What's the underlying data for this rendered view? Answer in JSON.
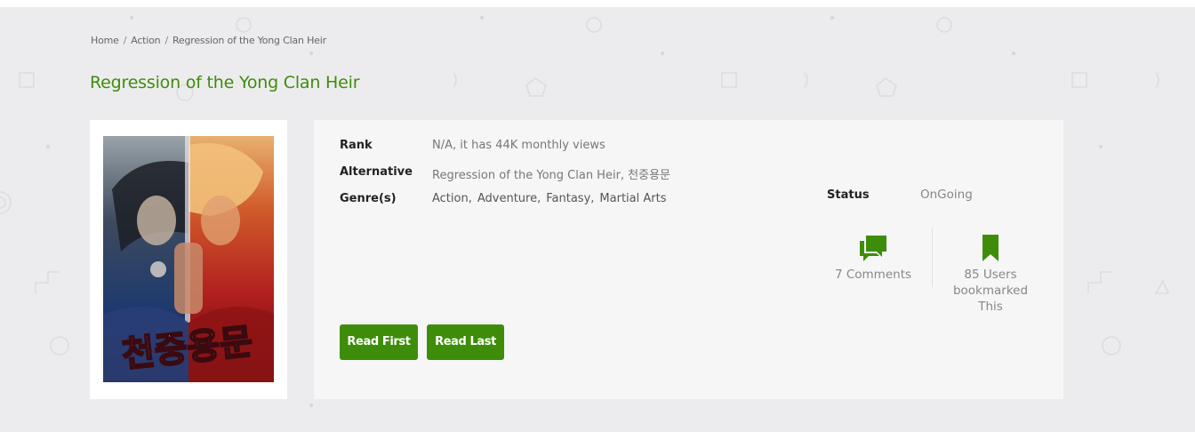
{
  "breadcrumb": {
    "home": "Home",
    "separator": "/",
    "category": "Action",
    "current": "Regression of the Yong Clan Heir"
  },
  "title": "Regression of the Yong Clan Heir",
  "cover": {
    "art_text": "천중용문"
  },
  "info": {
    "rank_label": "Rank",
    "rank_value": "N/A, it has 44K monthly views",
    "alternative_label": "Alternative",
    "alternative_value": "Regression of the Yong Clan Heir, 천중용문",
    "genres_label": "Genre(s)",
    "genres": [
      "Action",
      "Adventure",
      "Fantasy",
      "Martial Arts"
    ],
    "status_label": "Status",
    "status_value": "OnGoing"
  },
  "stats": {
    "comments_icon": "comments-icon",
    "comments": "7 Comments",
    "bookmark_icon": "bookmark-icon",
    "bookmarks_line1": "85 Users",
    "bookmarks_line2": "bookmarked",
    "bookmarks_line3": "This"
  },
  "buttons": {
    "read_first": "Read First",
    "read_last": "Read Last"
  },
  "colors": {
    "accent": "#3e8d0a",
    "background": "#ececee",
    "card": "#f6f6f6"
  }
}
